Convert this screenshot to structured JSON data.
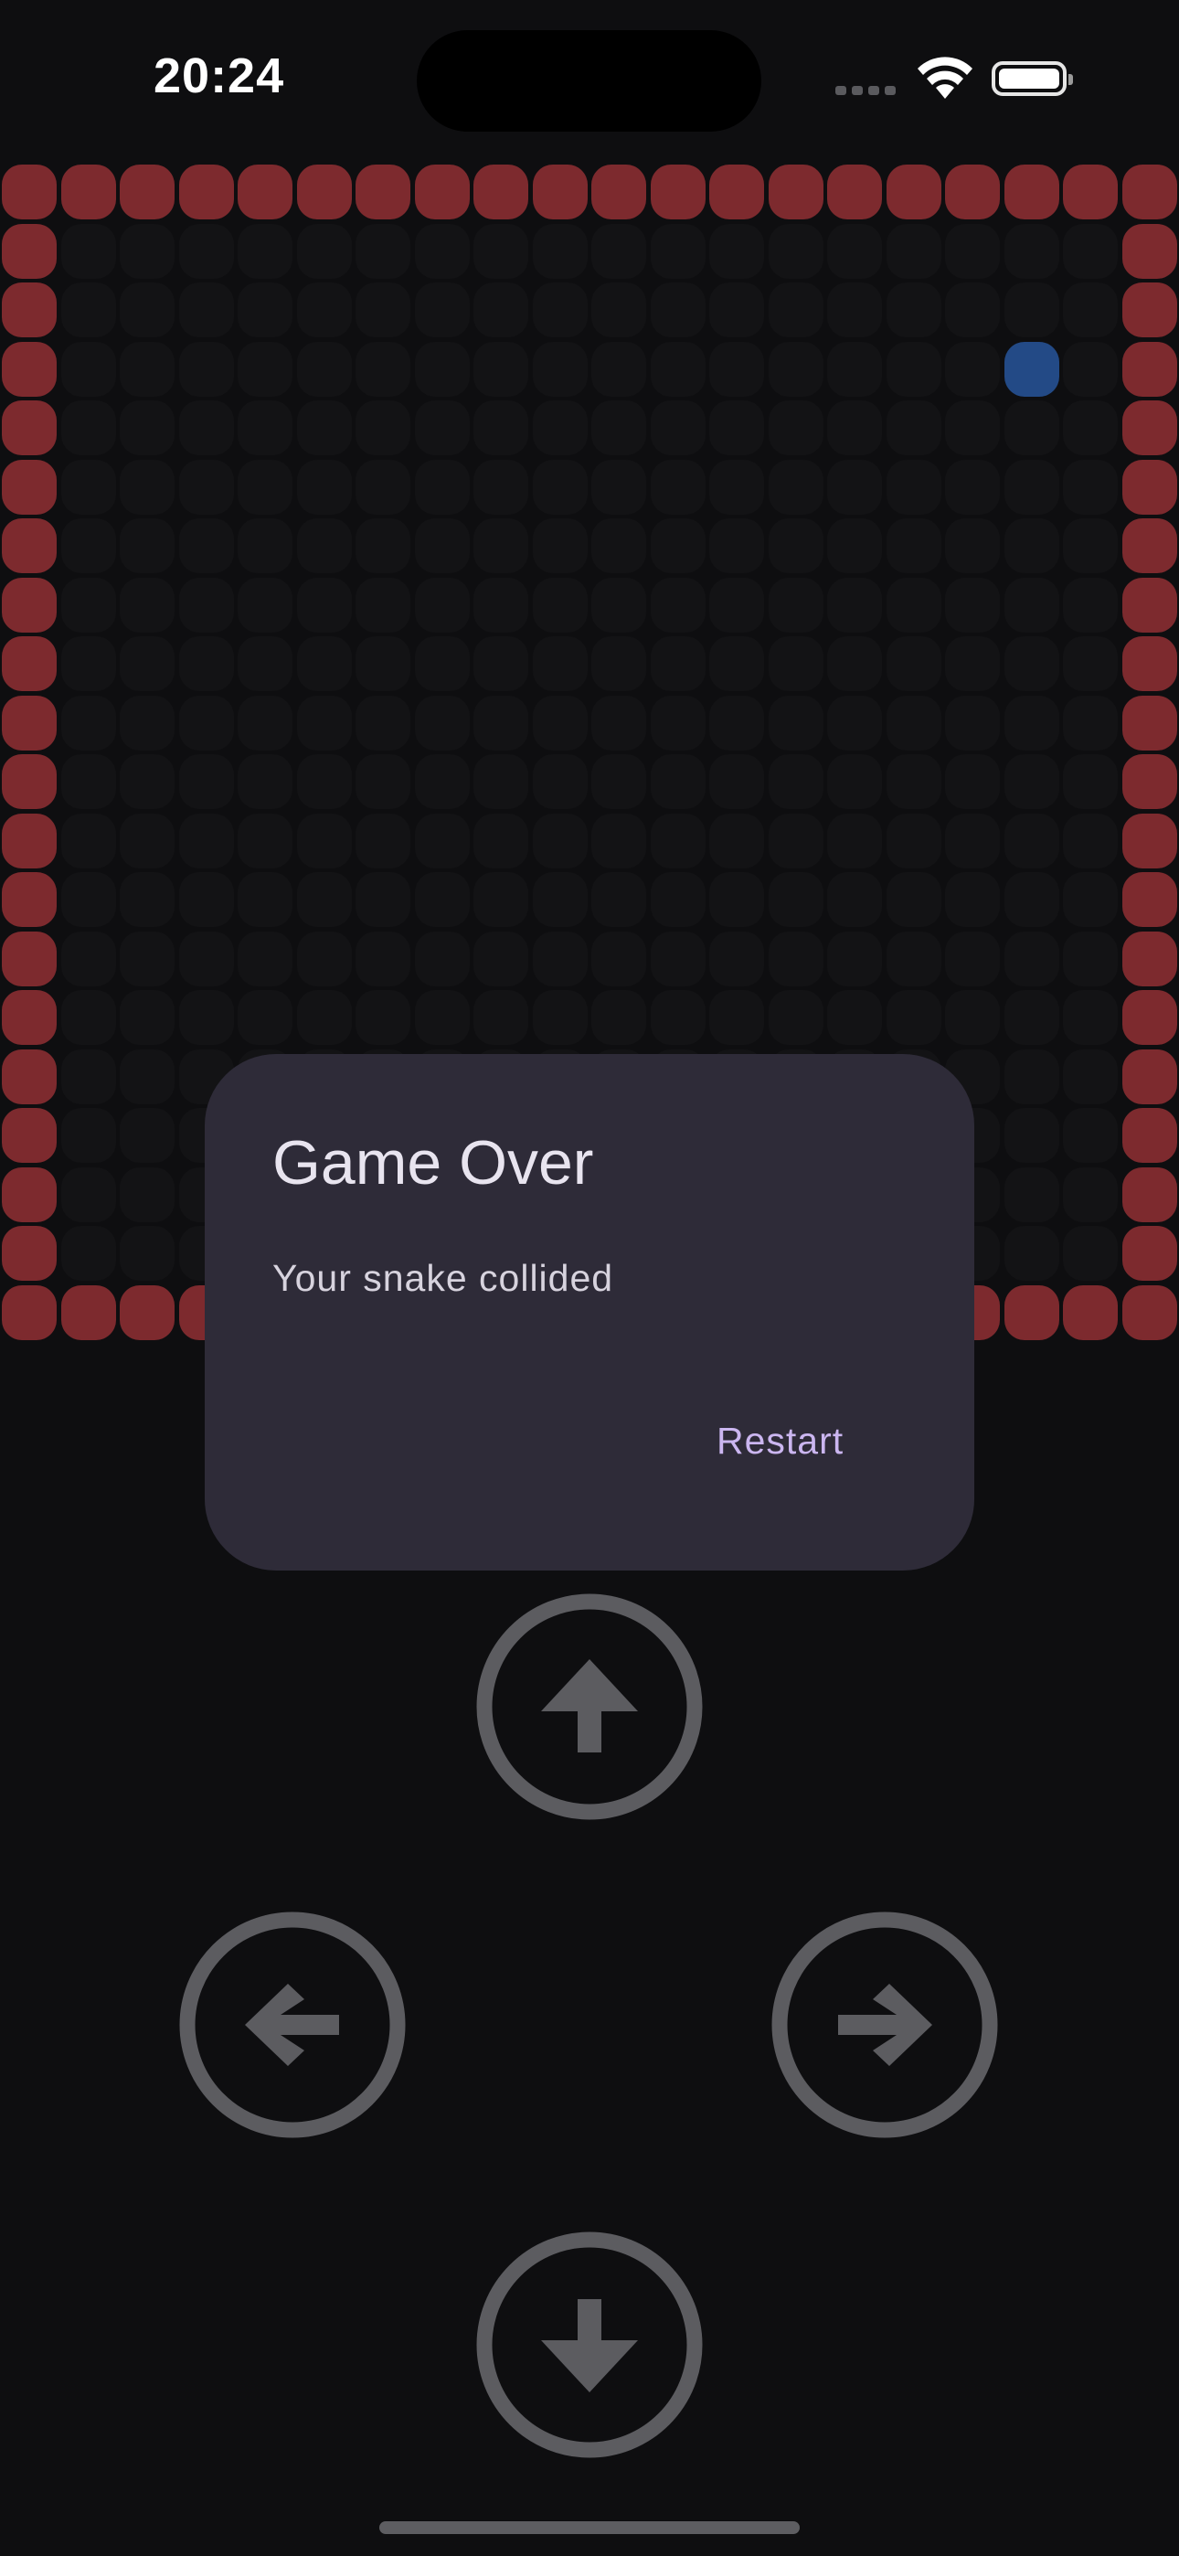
{
  "status_bar": {
    "time": "20:24",
    "icons": [
      "cellular-signal-icon",
      "wifi-icon",
      "battery-icon"
    ]
  },
  "game": {
    "grid_size": 20,
    "wall_color": "#7d2a2e",
    "empty_cell_color": "#131315",
    "food_color": "#234a86",
    "food": {
      "col": 17,
      "row": 3
    }
  },
  "dialog": {
    "title": "Game Over",
    "message": "Your snake collided",
    "restart_label": "Restart"
  },
  "controls": {
    "color": "#5c5c60",
    "up": "arrow-up-icon",
    "left": "arrow-left-icon",
    "right": "arrow-right-icon",
    "down": "arrow-down-icon"
  }
}
